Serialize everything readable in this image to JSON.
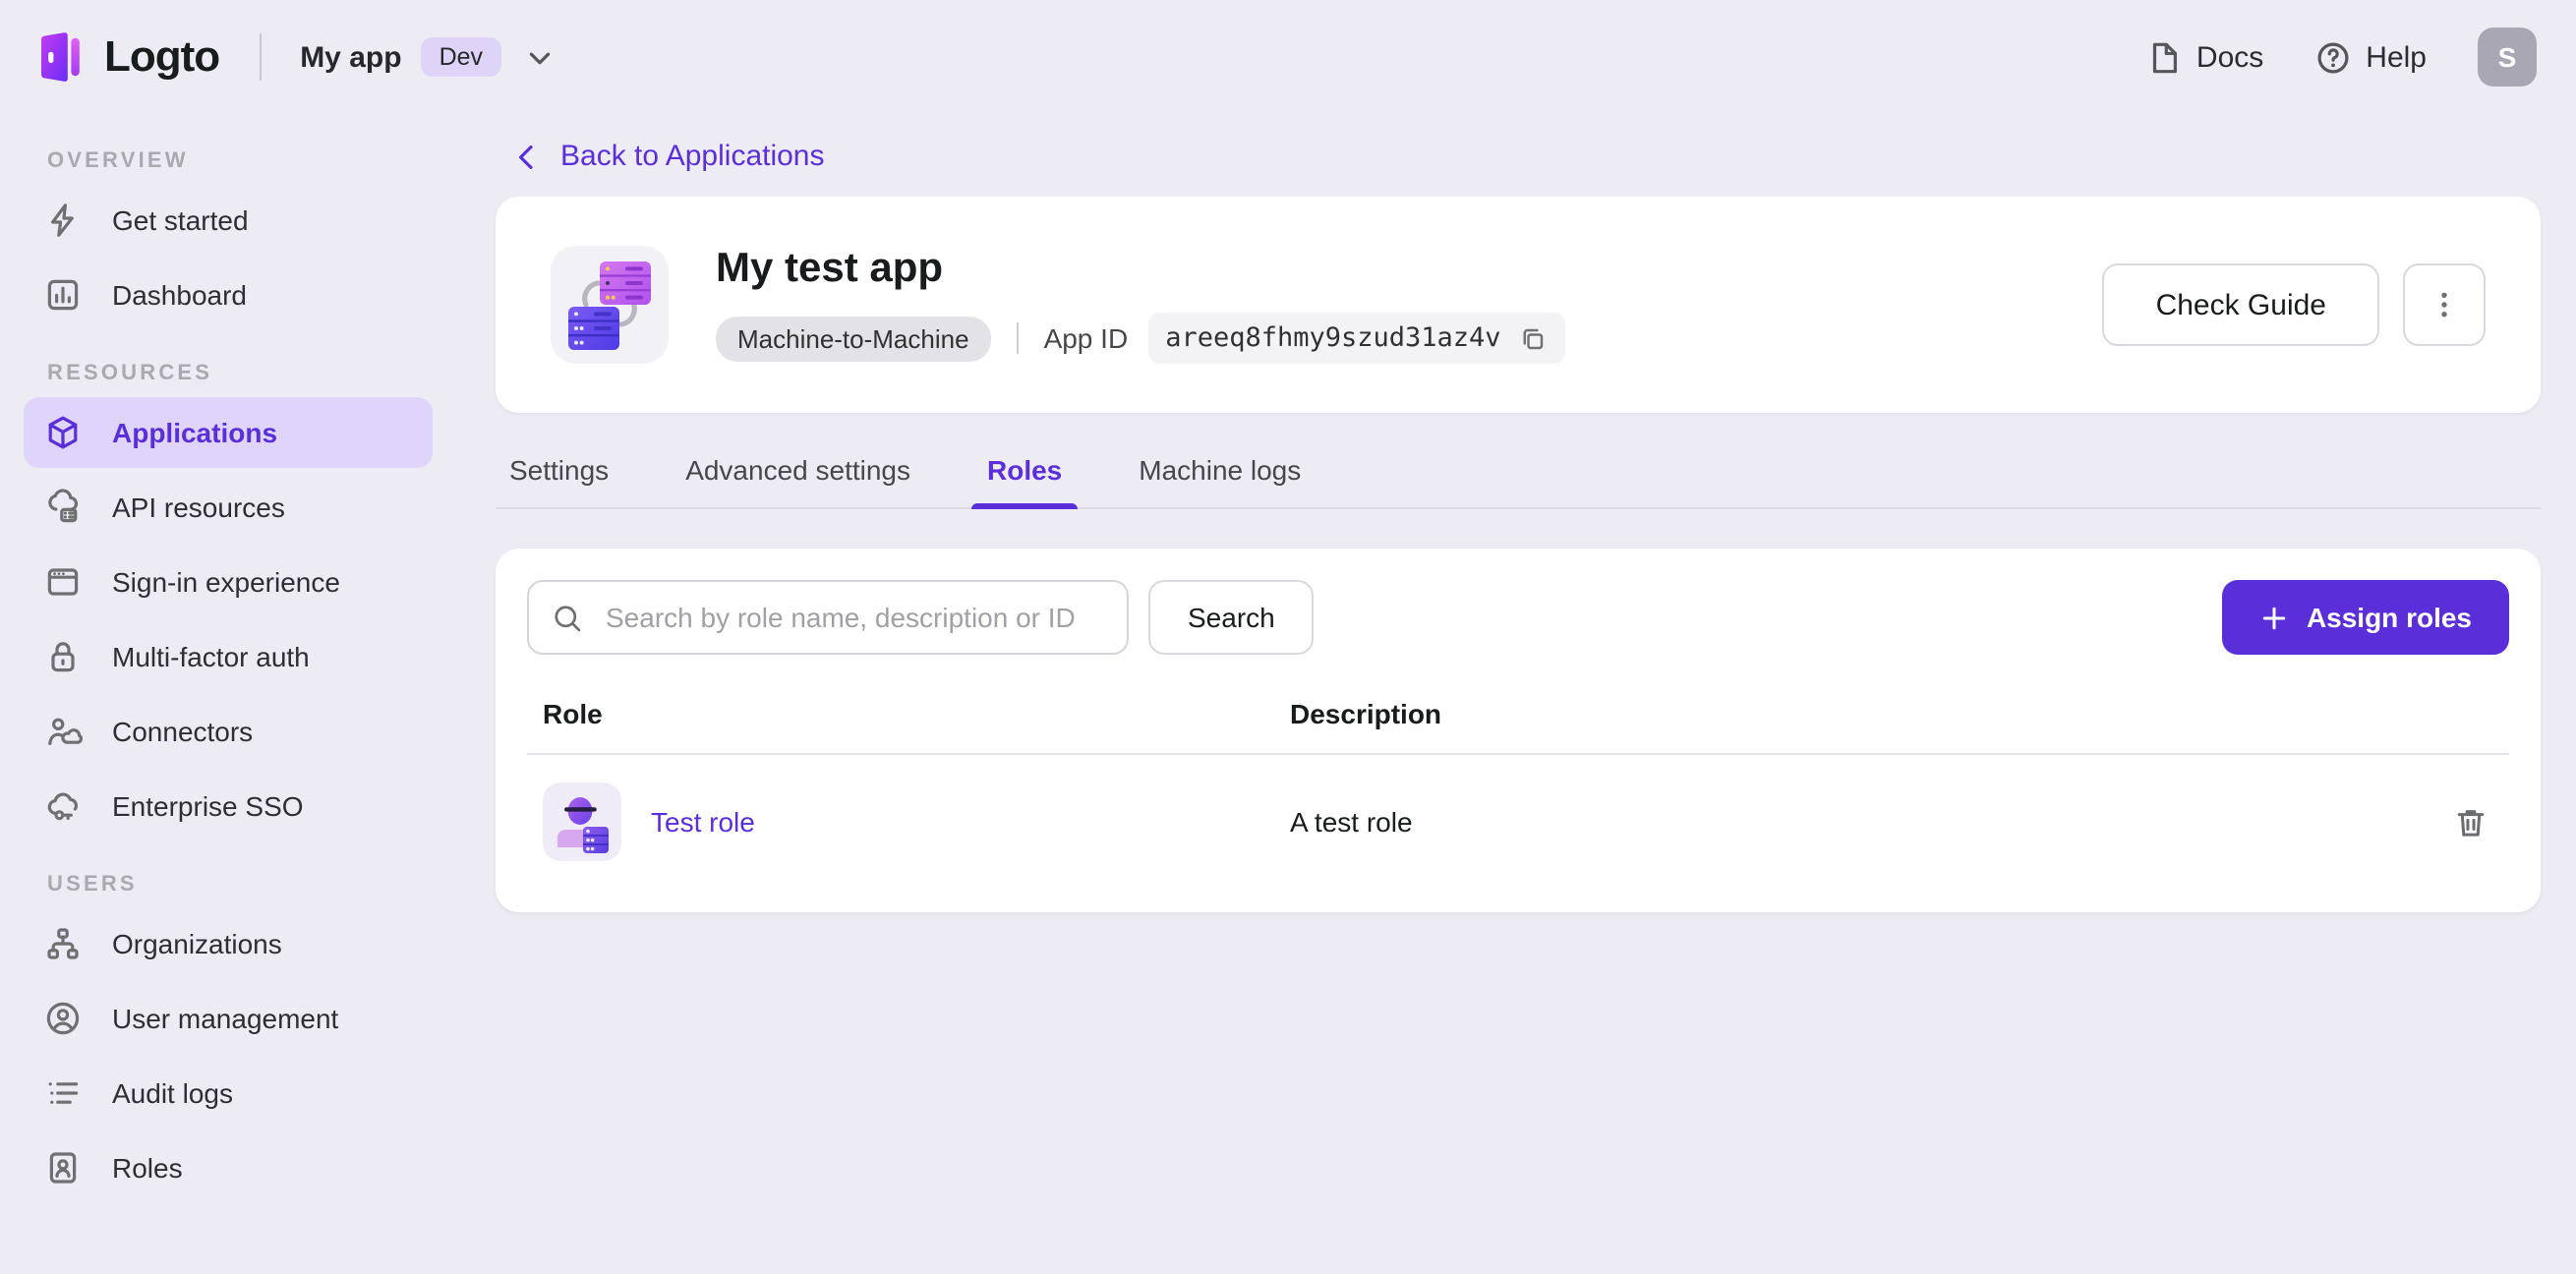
{
  "topbar": {
    "brand": "Logto",
    "tenant": {
      "name": "My app",
      "env_tag": "Dev"
    },
    "docs_label": "Docs",
    "help_label": "Help",
    "avatar_initial": "S"
  },
  "sidebar": {
    "sections": [
      {
        "title": "OVERVIEW",
        "items": [
          {
            "label": "Get started",
            "icon": "lightning-icon"
          },
          {
            "label": "Dashboard",
            "icon": "bar-chart-icon"
          }
        ]
      },
      {
        "title": "RESOURCES",
        "items": [
          {
            "label": "Applications",
            "icon": "cube-icon",
            "active": true
          },
          {
            "label": "API resources",
            "icon": "cloud-box-icon"
          },
          {
            "label": "Sign-in experience",
            "icon": "browser-icon"
          },
          {
            "label": "Multi-factor auth",
            "icon": "lock-icon"
          },
          {
            "label": "Connectors",
            "icon": "person-cloud-icon"
          },
          {
            "label": "Enterprise SSO",
            "icon": "cloud-key-icon"
          }
        ]
      },
      {
        "title": "USERS",
        "items": [
          {
            "label": "Organizations",
            "icon": "org-tree-icon"
          },
          {
            "label": "User management",
            "icon": "user-circle-icon"
          },
          {
            "label": "Audit logs",
            "icon": "list-icon"
          },
          {
            "label": "Roles",
            "icon": "id-badge-icon"
          }
        ]
      }
    ]
  },
  "main": {
    "back_link": "Back to Applications",
    "app_card": {
      "title": "My test app",
      "type_badge": "Machine-to-Machine",
      "app_id_label": "App ID",
      "app_id_value": "areeq8fhmy9szud31az4v",
      "check_guide_label": "Check Guide"
    },
    "tabs": [
      {
        "label": "Settings"
      },
      {
        "label": "Advanced settings"
      },
      {
        "label": "Roles",
        "active": true
      },
      {
        "label": "Machine logs"
      }
    ],
    "roles_panel": {
      "search_placeholder": "Search by role name, description or ID",
      "search_button_label": "Search",
      "assign_button_label": "Assign roles",
      "table": {
        "columns": [
          "Role",
          "Description"
        ],
        "rows": [
          {
            "role_name": "Test role",
            "description": "A test role"
          }
        ]
      }
    }
  },
  "colors": {
    "accent": "#5a2fd9",
    "accent_light_bg": "#dfd5fa",
    "page_bg": "#edebf4",
    "card_bg": "#ffffff",
    "text_primary": "#191c1d",
    "icon_gray": "#6e7072"
  }
}
